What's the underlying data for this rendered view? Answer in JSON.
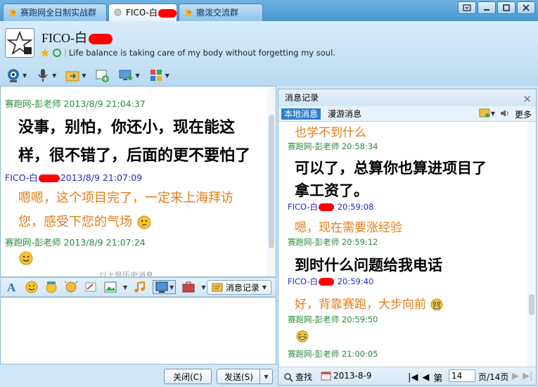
{
  "tabs": [
    {
      "label": "赛跑网全日制实战群"
    },
    {
      "label": "FICO-白"
    },
    {
      "label": "撤泼交流群"
    }
  ],
  "contact": {
    "name": "FICO-白",
    "signature": "Life balance is taking care of my body without forgetting my soul."
  },
  "chat": {
    "messages": [
      {
        "sender": "赛跑网-彭老师",
        "time": "2013/8/9 21:04:37",
        "lines": [
          "没事，别怕，你还小，现在能这",
          "样，很不错了，后面的更不要怕了"
        ]
      },
      {
        "sender": "FICO-白",
        "time": "2013/8/9 21:07:09",
        "lines": [
          "嗯嗯，这个项目完了，一定来上海拜访",
          "您，感受下您的气场"
        ]
      },
      {
        "sender": "赛跑网-彭老师",
        "time": "2013/8/9 21:07:24"
      }
    ],
    "history_hint": "以上是历史消息"
  },
  "editor_toolbar": {
    "message_record_label": "消息记录"
  },
  "buttons": {
    "close": "关闭(C)",
    "send": "发送(S)"
  },
  "history": {
    "title": "消息记录",
    "tab_local": "本地消息",
    "tab_roaming": "漫游消息",
    "more": "更多",
    "entries": [
      {
        "text": "也学不到什么"
      },
      {
        "sender": "赛跑网-彭老师",
        "time": "20:58:34"
      },
      {
        "text": "可以了，总算你也算进项目了"
      },
      {
        "text": "拿工资了。"
      },
      {
        "sender": "FICO-白",
        "time": "20:59:08"
      },
      {
        "text": "嗯，现在需要涨经验"
      },
      {
        "sender": "赛跑网-彭老师",
        "time": "20:59:12"
      },
      {
        "text": "到时什么问题给我电话"
      },
      {
        "sender": "FICO-白",
        "time": "20:59:40"
      },
      {
        "text": "好，背靠赛跑，大步向前"
      },
      {
        "sender": "赛跑网-彭老师",
        "time": "20:59:50"
      },
      {
        "sender": "赛跑网-彭老师",
        "time": "21:00:05"
      }
    ],
    "footer": {
      "search": "查找",
      "date": "2013-8-9",
      "page_prefix": "第",
      "page_value": "14",
      "page_suffix": "页/14页"
    }
  },
  "colors": {
    "sender_green": "#2c8a3c",
    "sender_blue": "#1d2bd0",
    "msg_orange": "#e47c16",
    "accent_blue": "#2f7fd0"
  }
}
